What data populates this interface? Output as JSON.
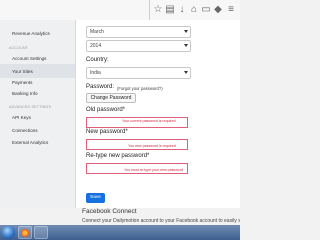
{
  "sidebar": {
    "items": [
      {
        "label": "Revenue Analytics",
        "section": ""
      },
      {
        "label": "Account Settings",
        "section": "ACCOUNT"
      },
      {
        "label": "Your Sites",
        "section": ""
      },
      {
        "label": "Payments",
        "section": ""
      },
      {
        "label": "Banking Info",
        "section": ""
      },
      {
        "label": "API Keys",
        "section": "ADVANCED SETTINGS"
      },
      {
        "label": "Connections",
        "section": ""
      },
      {
        "label": "External Analytics",
        "section": ""
      }
    ],
    "section_account": "ACCOUNT",
    "section_advanced": "ADVANCED SETTINGS"
  },
  "form": {
    "month_value": "March",
    "year_value": "2014",
    "country_label": "Country:",
    "country_value": "India",
    "password_label": "Password:",
    "forgot_link": "(Forgot your password?)",
    "change_password_button": "Change Password",
    "old_password_label": "Old password*",
    "old_password_error": "Your current password is required",
    "new_password_label": "New password*",
    "new_password_error": "You new password is required",
    "retype_password_label": "Re-type new password*",
    "retype_password_error": "You must re-type your new password",
    "save_button": "Save"
  },
  "facebook": {
    "title": "Facebook Connect",
    "description": "Connect your Dailymotion account to your Facebook account to easily sync"
  },
  "colors": {
    "error": "#d2283f",
    "primary_button": "#1570e0"
  }
}
